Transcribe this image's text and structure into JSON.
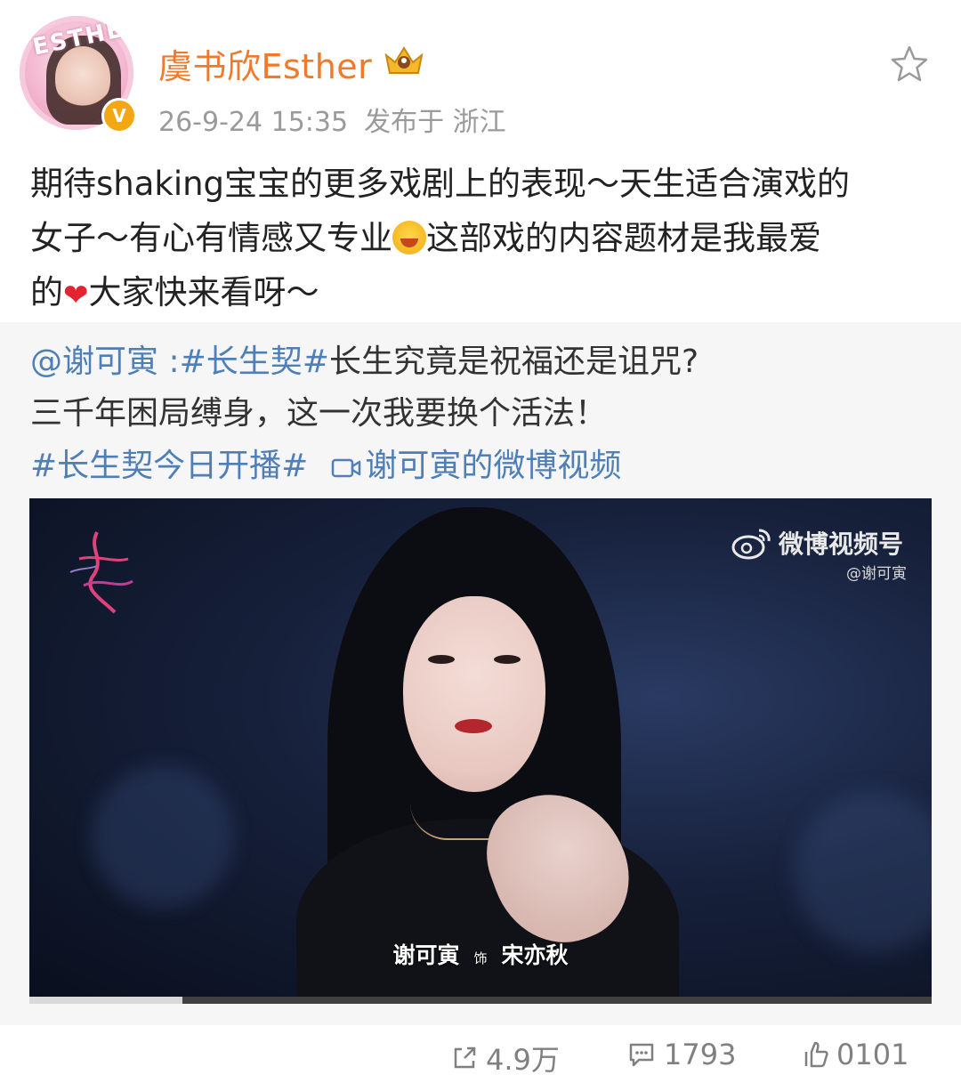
{
  "post": {
    "user_name": "虞书欣Esther",
    "avatar_text": "ESTHER",
    "verified_mark": "V",
    "timestamp": "26-9-24 15:35",
    "location": "发布于 浙江",
    "text_line1": "期待shaking宝宝的更多戏剧上的表现～天生适合演戏的",
    "text_line2a": "女子～有心有情感又专业",
    "text_line2b": "这部戏的内容题材是我最爱",
    "text_line3a": "的",
    "text_line3b": "大家快来看呀～",
    "heart": "❤"
  },
  "repost": {
    "mention": "@谢可寅",
    "colon": " :",
    "hashtag1": "#长生契#",
    "text1": "长生究竟是祝福还是诅咒?",
    "text2": "三千年困局缚身，这一次我要换个活法！",
    "hashtag2": "#长生契今日开播#",
    "video_link": "谢可寅的微博视频"
  },
  "video": {
    "watermark_title": "微博视频号",
    "watermark_sub": "@谢可寅",
    "actor": "谢可寅",
    "role_word": "饰",
    "character": "宋亦秋",
    "progress": 0.17
  },
  "actions": {
    "share_count": "4.9万",
    "comment_count": "1793",
    "like_count": "0101"
  },
  "colors": {
    "name": "#f0792a",
    "link": "#4f7fb7",
    "meta": "#9a9a9a"
  }
}
